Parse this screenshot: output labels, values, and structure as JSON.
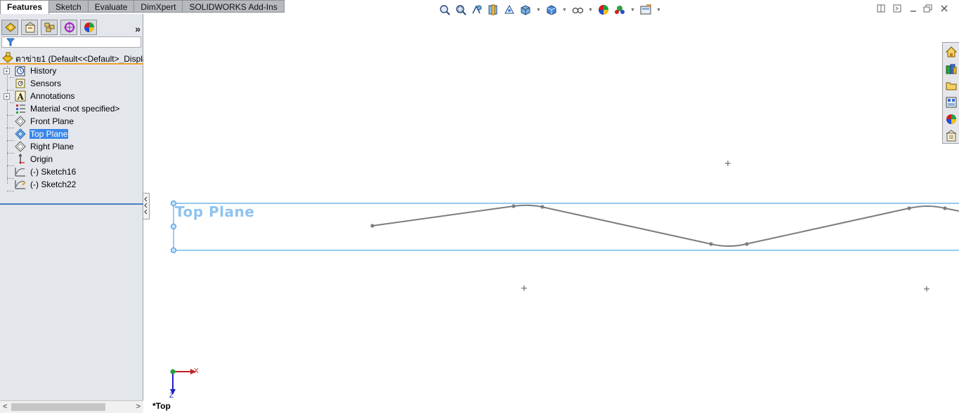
{
  "command_tabs": [
    "Features",
    "Sketch",
    "Evaluate",
    "DimXpert",
    "SOLIDWORKS Add-Ins"
  ],
  "active_tab_index": 0,
  "panel_tabs": [
    "feature-manager-icon",
    "property-manager-icon",
    "configuration-manager-icon",
    "dimxpert-manager-icon",
    "display-manager-icon"
  ],
  "panel_more": "»",
  "root_item": {
    "label": "ตาข่าย1  (Default<<Default>_Display"
  },
  "tree_items": [
    {
      "label": "History",
      "icon": "history-icon",
      "expandable": true
    },
    {
      "label": "Sensors",
      "icon": "sensors-icon",
      "expandable": false
    },
    {
      "label": "Annotations",
      "icon": "annotations-icon",
      "expandable": true
    },
    {
      "label": "Material <not specified>",
      "icon": "material-icon",
      "expandable": false
    },
    {
      "label": "Front Plane",
      "icon": "plane-icon",
      "expandable": false
    },
    {
      "label": "Top Plane",
      "icon": "plane-icon",
      "expandable": false,
      "selected": true
    },
    {
      "label": "Right Plane",
      "icon": "plane-icon",
      "expandable": false
    },
    {
      "label": "Origin",
      "icon": "origin-icon",
      "expandable": false
    },
    {
      "label": "(-) Sketch16",
      "icon": "sketch-icon",
      "expandable": false
    },
    {
      "label": "(-) Sketch22",
      "icon": "sketch-icon",
      "expandable": false
    }
  ],
  "viewport": {
    "plane_label": "Top Plane",
    "view_name": "*Top",
    "triad": {
      "x_label": "X",
      "z_label": "Z"
    },
    "colors": {
      "plane": "#5aaae6",
      "plane_label": "#8fc3f0",
      "curve": "#7d7d7d"
    }
  },
  "scroll": {
    "left": "<",
    "right": ">"
  }
}
